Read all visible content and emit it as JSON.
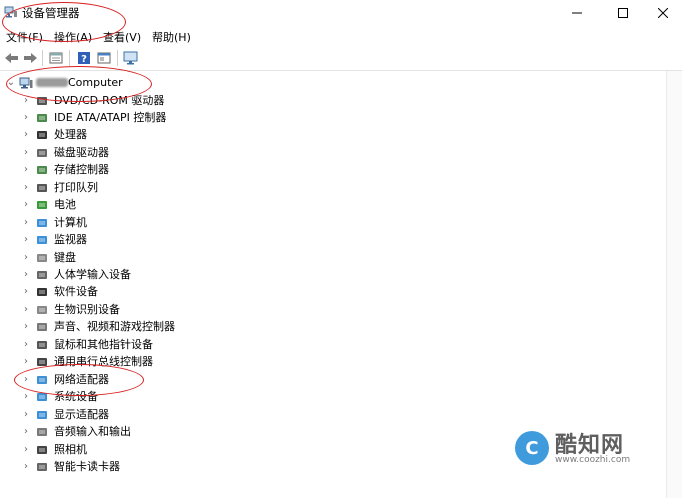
{
  "window": {
    "title": "设备管理器",
    "minimize": "—",
    "maximize": "☐",
    "close": "✕"
  },
  "menu": {
    "file": "文件(F)",
    "action": "操作(A)",
    "view": "查看(V)",
    "help": "帮助(H)"
  },
  "tree": {
    "root": {
      "label": "Computer",
      "expander": "⌄"
    },
    "items": [
      {
        "label": "DVD/CD-ROM 驱动器",
        "icon": "dvd-drive-icon"
      },
      {
        "label": "IDE ATA/ATAPI 控制器",
        "icon": "ide-controller-icon"
      },
      {
        "label": "处理器",
        "icon": "processor-icon"
      },
      {
        "label": "磁盘驱动器",
        "icon": "disk-drive-icon"
      },
      {
        "label": "存储控制器",
        "icon": "storage-controller-icon"
      },
      {
        "label": "打印队列",
        "icon": "printer-icon"
      },
      {
        "label": "电池",
        "icon": "battery-icon"
      },
      {
        "label": "计算机",
        "icon": "computer-icon"
      },
      {
        "label": "监视器",
        "icon": "monitor-icon"
      },
      {
        "label": "键盘",
        "icon": "keyboard-icon"
      },
      {
        "label": "人体学输入设备",
        "icon": "hid-icon"
      },
      {
        "label": "软件设备",
        "icon": "software-device-icon"
      },
      {
        "label": "生物识别设备",
        "icon": "biometric-icon"
      },
      {
        "label": "声音、视频和游戏控制器",
        "icon": "speaker-icon"
      },
      {
        "label": "鼠标和其他指针设备",
        "icon": "mouse-icon"
      },
      {
        "label": "通用串行总线控制器",
        "icon": "usb-icon"
      },
      {
        "label": "网络适配器",
        "icon": "network-adapter-icon"
      },
      {
        "label": "系统设备",
        "icon": "system-device-icon"
      },
      {
        "label": "显示适配器",
        "icon": "display-adapter-icon"
      },
      {
        "label": "音频输入和输出",
        "icon": "audio-io-icon"
      },
      {
        "label": "照相机",
        "icon": "camera-icon"
      },
      {
        "label": "智能卡读卡器",
        "icon": "smart-card-reader-icon"
      }
    ],
    "collapsed_glyph": "›"
  },
  "watermark": {
    "logo_letter": "C",
    "title": "酷知网",
    "url": "www.coozhi.com"
  },
  "colors": {
    "annotation": "#d82020",
    "watermark_blue": "#1e8ad6"
  }
}
